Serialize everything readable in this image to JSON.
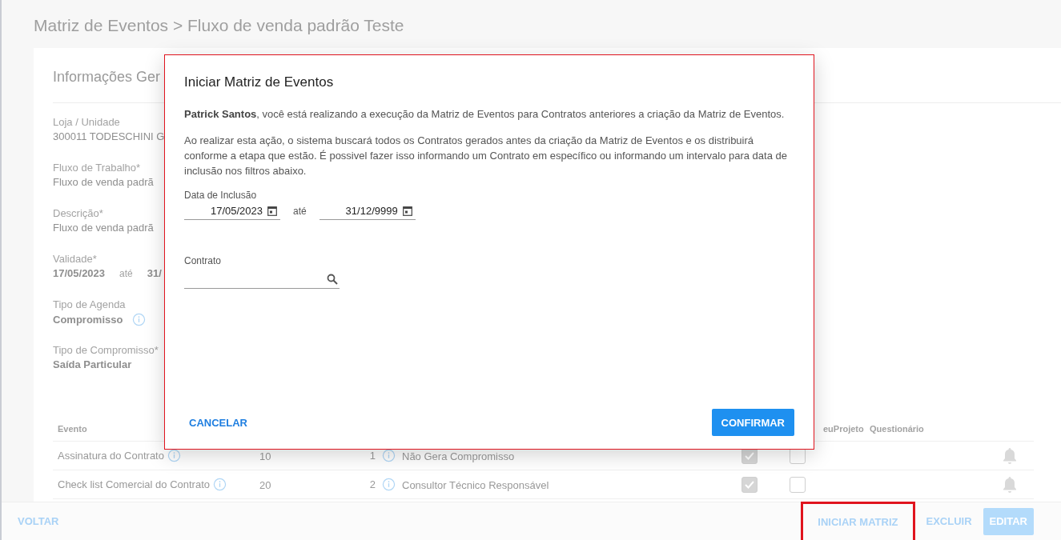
{
  "page": {
    "breadcrumb": "Matriz de Eventos > Fluxo de venda padrão Teste",
    "section_title": "Informações Ger",
    "fields": [
      {
        "label": "Loja / Unidade",
        "value": "300011 TODESCHINI G"
      },
      {
        "label": "Fluxo de Trabalho*",
        "value": "Fluxo de venda padrã"
      },
      {
        "label": "Descrição*",
        "value": "Fluxo de venda padrã"
      },
      {
        "label": "Validade*",
        "value": "17/05/2023",
        "separator": "até",
        "value_end": "31/"
      },
      {
        "label": "Tipo de Agenda",
        "value": "Compromisso",
        "info": true
      },
      {
        "label": "Tipo de Compromisso*",
        "value": "Saída Particular"
      }
    ],
    "table": {
      "columns": [
        "Evento",
        "euProjeto",
        "Questionário"
      ],
      "rows": [
        {
          "event": "Assinatura do Contrato",
          "column_2": "10",
          "column_3": "1",
          "column_4": "Não Gera Compromisso",
          "check_1": true,
          "check_2": false
        },
        {
          "event": "Check list Comercial do Contrato",
          "column_2": "20",
          "column_3": "2",
          "column_4": "Consultor Técnico Responsável",
          "check_1": true,
          "check_2": false
        }
      ]
    }
  },
  "footer": {
    "back": "VOLTAR",
    "buttons": [
      {
        "label": "INICIAR MATRIZ",
        "kind": "text",
        "highlighted": true
      },
      {
        "label": "EXCLUIR",
        "kind": "text",
        "highlighted": false
      },
      {
        "label": "EDITAR",
        "kind": "filled",
        "highlighted": false
      }
    ]
  },
  "dialog": {
    "title": "Iniciar Matriz de Eventos",
    "highlighted": true,
    "paragraphs": [
      "**Patrick Santos**, você está realizando a execução da Matriz de Eventos para Contratos anteriores a criação da Matriz de Eventos.",
      "Ao realizar esta ação, o sistema buscará todos os Contratos gerados antes da criação da Matriz de Eventos e os distribuirá conforme a etapa que estão. É possivel fazer isso informando um Contrato em específico ou informando um intervalo para data de inclusão nos filtros abaixo."
    ],
    "date_label": "Data de Inclusão",
    "date_start": "17/05/2023",
    "date_separator": "até",
    "date_end": "31/12/9999",
    "contract_label": "Contrato",
    "cancel": "CANCELAR",
    "confirm": "CONFIRMAR"
  }
}
